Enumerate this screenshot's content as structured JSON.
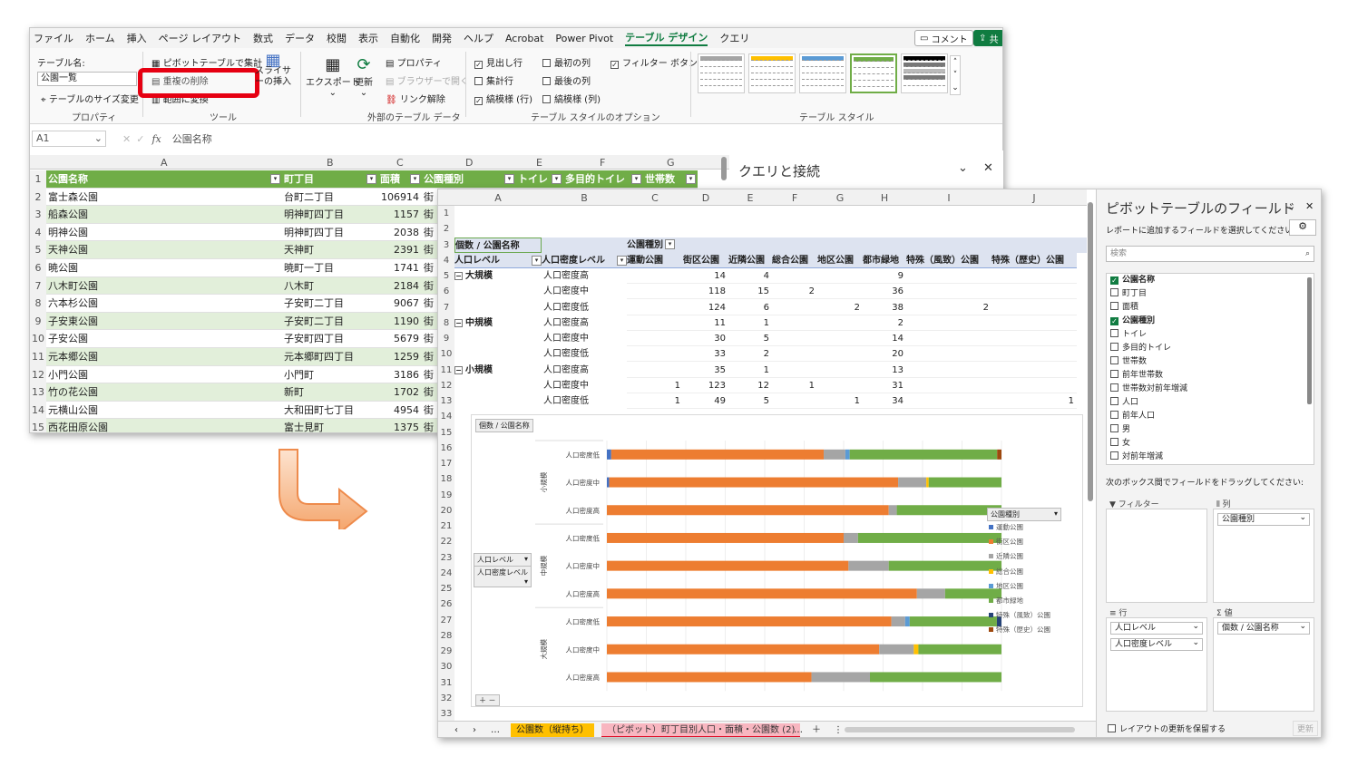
{
  "excel1": {
    "menu": [
      "ファイル",
      "ホーム",
      "挿入",
      "ページ レイアウト",
      "数式",
      "データ",
      "校閲",
      "表示",
      "自動化",
      "開発",
      "ヘルプ",
      "Acrobat",
      "Power Pivot",
      "テーブル デザイン",
      "クエリ"
    ],
    "comment_btn": "コメント",
    "share_btn": "共",
    "ribbon": {
      "table_name_label": "テーブル名:",
      "table_name_value": "公園一覧",
      "resize": "テーブルのサイズ変更",
      "grp_props": "プロパティ",
      "pivot": "ピボットテーブルで集計",
      "dedupe": "重複の削除",
      "to_range": "範囲に変換",
      "grp_tools": "ツール",
      "slicer": "スライサーの挿入",
      "export": "エクスポート",
      "refresh": "更新",
      "props2": "プロパティ",
      "browser": "ブラウザーで開く",
      "unlink": "リンク解除",
      "grp_ext": "外部のテーブル データ",
      "opt_header": "見出し行",
      "opt_total": "集計行",
      "opt_banded": "縞模様 (行)",
      "opt_first": "最初の列",
      "opt_last": "最後の列",
      "opt_bandcol": "縞模様 (列)",
      "opt_filter": "フィルター ボタン",
      "grp_opts": "テーブル スタイルのオプション",
      "grp_styles": "テーブル スタイル"
    },
    "namebox": "A1",
    "formula": "公園名称",
    "cols": [
      "A",
      "B",
      "C",
      "D",
      "E",
      "F",
      "G"
    ],
    "headers": [
      "公園名称",
      "町丁目",
      "面積",
      "公園種別",
      "トイレ",
      "多目的トイレ",
      "世帯数"
    ],
    "rows": [
      [
        "富士森公園",
        "台町二丁目",
        "106914",
        "街"
      ],
      [
        "船森公園",
        "明神町四丁目",
        "1157",
        "街"
      ],
      [
        "明神公園",
        "明神町四丁目",
        "2038",
        "街"
      ],
      [
        "天神公園",
        "天神町",
        "2391",
        "街"
      ],
      [
        "暁公園",
        "暁町一丁目",
        "1741",
        "街"
      ],
      [
        "八木町公園",
        "八木町",
        "2184",
        "街"
      ],
      [
        "六本杉公園",
        "子安町二丁目",
        "9067",
        "街"
      ],
      [
        "子安東公園",
        "子安町二丁目",
        "1190",
        "街"
      ],
      [
        "子安公園",
        "子安町四丁目",
        "5679",
        "街"
      ],
      [
        "元本郷公園",
        "元本郷町四丁目",
        "1259",
        "街"
      ],
      [
        "小門公園",
        "小門町",
        "3186",
        "街"
      ],
      [
        "竹の花公園",
        "新町",
        "1702",
        "街"
      ],
      [
        "元横山公園",
        "大和田町七丁目",
        "4954",
        "街"
      ],
      [
        "西花田原公園",
        "富士見町",
        "1375",
        "街"
      ]
    ],
    "query_pane": "クエリと接続"
  },
  "excel2": {
    "cols": [
      "A",
      "B",
      "C",
      "D",
      "E",
      "F",
      "G",
      "H",
      "I",
      "J"
    ],
    "r3": {
      "a": "個数 / 公園名称",
      "c": "公園種別"
    },
    "r4": [
      "人口レベル",
      "人口密度レベル",
      "運動公園",
      "街区公園",
      "近隣公園",
      "総合公園",
      "地区公園",
      "都市緑地",
      "特殊（風致）公園",
      "特殊（歴史）公園"
    ],
    "groups": [
      "大規模",
      "中規模",
      "小規模"
    ],
    "dens": [
      "人口密度高",
      "人口密度中",
      "人口密度低"
    ],
    "pivot_rows": [
      [
        "",
        "14",
        "4",
        "",
        "",
        "9",
        "",
        ""
      ],
      [
        "",
        "118",
        "15",
        "2",
        "",
        "36",
        "",
        ""
      ],
      [
        "",
        "124",
        "6",
        "",
        "2",
        "38",
        "2",
        ""
      ],
      [
        "",
        "11",
        "1",
        "",
        "",
        "2",
        "",
        ""
      ],
      [
        "",
        "30",
        "5",
        "",
        "",
        "14",
        "",
        ""
      ],
      [
        "",
        "33",
        "2",
        "",
        "",
        "20",
        "",
        ""
      ],
      [
        "",
        "35",
        "1",
        "",
        "",
        "13",
        "",
        ""
      ],
      [
        "1",
        "123",
        "12",
        "1",
        "",
        "31",
        "",
        ""
      ],
      [
        "1",
        "49",
        "5",
        "",
        "1",
        "34",
        "",
        "1"
      ]
    ],
    "chart_btn": "個数 / 公園名称",
    "row_btn1": "人口レベル",
    "row_btn2": "人口密度レベル",
    "legend_btn": "公園種別",
    "chart_groups": [
      "小規模",
      "中規模",
      "大規模"
    ],
    "sheet_tab1": "公園数（縦持ち）",
    "sheet_tab2": "（ピボット）町丁目別人口・面積・公園数 (2)",
    "fields": {
      "title": "ピボットテーブルのフィールド",
      "sub": "レポートに追加するフィールドを選択してください:",
      "search": "検索",
      "list": [
        [
          "公園名称",
          true
        ],
        [
          "町丁目",
          false
        ],
        [
          "面積",
          false
        ],
        [
          "公園種別",
          true
        ],
        [
          "トイレ",
          false
        ],
        [
          "多目的トイレ",
          false
        ],
        [
          "世帯数",
          false
        ],
        [
          "前年世帯数",
          false
        ],
        [
          "世帯数対前年増減",
          false
        ],
        [
          "人口",
          false
        ],
        [
          "前年人口",
          false
        ],
        [
          "男",
          false
        ],
        [
          "女",
          false
        ],
        [
          "対前年増減",
          false
        ]
      ],
      "drag": "次のボックス間でフィールドをドラッグしてください:",
      "filter": "フィルター",
      "col": "列",
      "col_chip": "公園種別",
      "row": "行",
      "val": "値",
      "row_chip1": "人口レベル",
      "row_chip2": "人口密度レベル",
      "val_chip": "個数 / 公園名称",
      "defer": "レイアウトの更新を保留する",
      "update": "更新"
    }
  },
  "chart_data": {
    "type": "bar",
    "stacked": "100%",
    "orientation": "horizontal",
    "categories": [
      "小規模 / 人口密度低",
      "小規模 / 人口密度中",
      "小規模 / 人口密度高",
      "中規模 / 人口密度低",
      "中規模 / 人口密度中",
      "中規模 / 人口密度高",
      "大規模 / 人口密度低",
      "大規模 / 人口密度中",
      "大規模 / 人口密度高"
    ],
    "category_labels": [
      "人口密度低",
      "人口密度中",
      "人口密度高",
      "人口密度低",
      "人口密度中",
      "人口密度高",
      "人口密度低",
      "人口密度中",
      "人口密度高"
    ],
    "series": [
      {
        "name": "運動公園",
        "color": "#4472c4",
        "values": [
          1,
          1,
          0,
          0,
          0,
          0,
          0,
          0,
          0
        ]
      },
      {
        "name": "街区公園",
        "color": "#ed7d31",
        "values": [
          49,
          123,
          35,
          33,
          30,
          11,
          124,
          118,
          14
        ]
      },
      {
        "name": "近隣公園",
        "color": "#a5a5a5",
        "values": [
          5,
          12,
          1,
          2,
          5,
          1,
          6,
          15,
          4
        ]
      },
      {
        "name": "総合公園",
        "color": "#ffc000",
        "values": [
          0,
          1,
          0,
          0,
          0,
          0,
          0,
          2,
          0
        ]
      },
      {
        "name": "地区公園",
        "color": "#5b9bd5",
        "values": [
          1,
          0,
          0,
          0,
          0,
          0,
          2,
          0,
          0
        ]
      },
      {
        "name": "都市緑地",
        "color": "#70ad47",
        "values": [
          34,
          31,
          13,
          20,
          14,
          2,
          38,
          36,
          9
        ]
      },
      {
        "name": "特殊（風致）公園",
        "color": "#264478",
        "values": [
          0,
          0,
          0,
          0,
          0,
          0,
          2,
          0,
          0
        ]
      },
      {
        "name": "特殊（歴史）公園",
        "color": "#9e480e",
        "values": [
          1,
          0,
          0,
          0,
          0,
          0,
          0,
          0,
          0
        ]
      }
    ],
    "xticks": [
      "0%",
      "10%",
      "20%",
      "30%",
      "40%",
      "50%",
      "60%",
      "70%",
      "80%",
      "90%",
      "100%"
    ],
    "legend": "right"
  }
}
